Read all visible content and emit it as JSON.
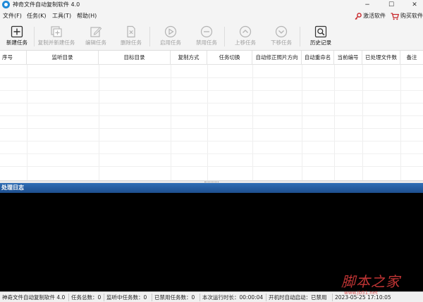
{
  "window": {
    "title": "神奇文件自动复制软件 4.0",
    "controls": {
      "minimize": "−",
      "maximize": "☐",
      "close": "✕"
    }
  },
  "menu": {
    "items": [
      {
        "label": "文件(F)"
      },
      {
        "label": "任务(K)"
      },
      {
        "label": "工具(T)"
      },
      {
        "label": "帮助(H)"
      }
    ],
    "activate_label": "激活软件",
    "buy_label": "购买软件"
  },
  "toolbar": {
    "buttons": [
      {
        "label": "新建任务",
        "icon": "plus-box-icon",
        "enabled": true
      },
      {
        "label": "复制并新建任务",
        "icon": "copy-add-icon",
        "enabled": false
      },
      {
        "label": "编辑任务",
        "icon": "edit-icon",
        "enabled": false
      },
      {
        "label": "删除任务",
        "icon": "delete-file-icon",
        "enabled": false
      },
      {
        "label": "启用任务",
        "icon": "play-icon",
        "enabled": false
      },
      {
        "label": "禁用任务",
        "icon": "minus-circle-icon",
        "enabled": false
      },
      {
        "label": "上移任务",
        "icon": "chevron-up-circle-icon",
        "enabled": false
      },
      {
        "label": "下移任务",
        "icon": "chevron-down-circle-icon",
        "enabled": false
      },
      {
        "label": "历史记录",
        "icon": "history-search-icon",
        "enabled": true
      }
    ]
  },
  "table": {
    "columns": [
      "序号",
      "监听目录",
      "目标目录",
      "复制方式",
      "任务切换",
      "自动修正照片方向",
      "自动重命名",
      "当前编号",
      "已处理文件数",
      "备注"
    ],
    "rows": []
  },
  "log": {
    "title": "处理日志"
  },
  "status": {
    "app_name": "神奇文件自动复制软件 4.0",
    "total_tasks": "任务总数：0",
    "listening_tasks": "监听中任务数：0",
    "disabled_tasks": "已禁用任务数：0",
    "run_time": "本次运行时长：00:00:04",
    "autostart": "开机时自动启动：已禁用",
    "datetime": "2023-05-25 17:10:05"
  },
  "watermark": {
    "main": "脚本之家",
    "sub": "www.jb51.net"
  },
  "colors": {
    "log_header": "#2f6db5",
    "log_body": "#000000",
    "watermark": "#d43a3a",
    "icon_disabled": "#b4b4b4",
    "icon_enabled": "#333333"
  }
}
